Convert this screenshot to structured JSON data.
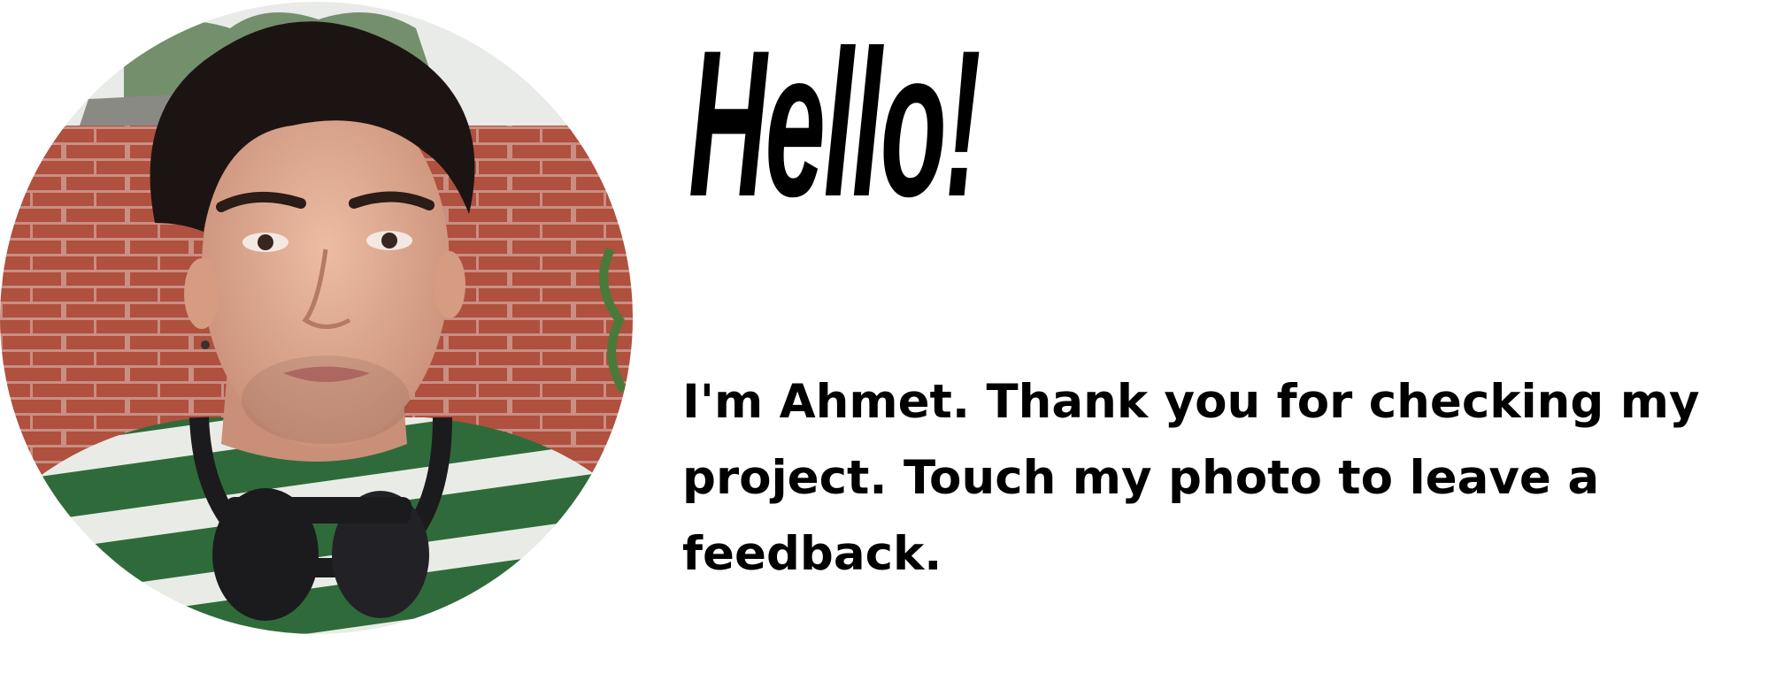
{
  "greeting": {
    "title": "Hello!"
  },
  "intro": {
    "message": "I'm Ahmet. Thank you for checking my project. Touch my photo to leave a feedback."
  },
  "photo": {
    "subject": "portrait photo of a young man with dark hair in front of a brick wall",
    "colors": {
      "brick": "#b0503e",
      "mortar": "#c98f82",
      "shirt_green": "#2f6b3a",
      "shirt_white": "#e9ece6",
      "skin": "#e0ad93",
      "hair": "#1c1412",
      "headphones": "#1b1b1d"
    }
  }
}
